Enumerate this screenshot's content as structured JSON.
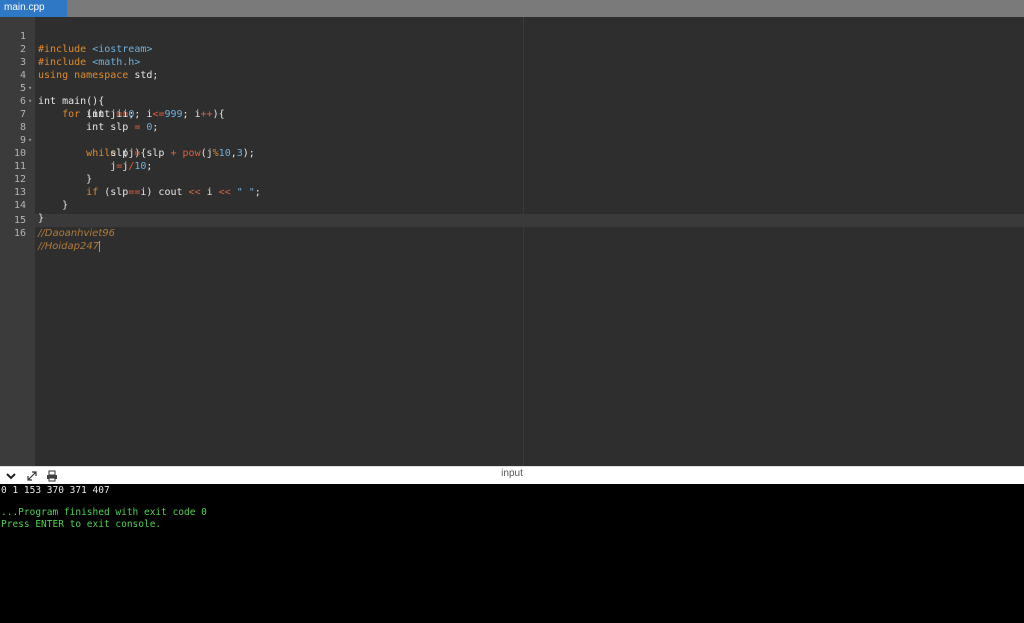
{
  "tab": {
    "label": "main.cpp"
  },
  "editor": {
    "line_numbers": [
      "1",
      "2",
      "3",
      "4",
      "5",
      "6",
      "7",
      "8",
      "9",
      "10",
      "11",
      "12",
      "13",
      "14",
      "15",
      "16"
    ],
    "code": {
      "l1a": "#include ",
      "l1b": "<iostream>",
      "l2a": "#include ",
      "l2b": "<math.h>",
      "l3a": "using namespace",
      "l3b": " std;",
      "l4": "int main(){",
      "l5a": "    ",
      "l5b": "for",
      "l5c": " (int i",
      "l5d": "=",
      "l5e": "0",
      "l5f": "; i",
      "l5g": "<=",
      "l5h": "999",
      "l5i": "; i",
      "l5j": "++",
      "l5k": "){",
      "l6a": "        int j",
      "l6b": "=",
      "l6c": "i;",
      "l7a": "        int slp ",
      "l7b": "=",
      "l7c": " ",
      "l7d": "0",
      "l7e": ";",
      "l8a": "        ",
      "l8b": "while",
      "l8c": " (j){",
      "l9a": "            slp ",
      "l9b": "=",
      "l9c": " slp ",
      "l9d": "+",
      "l9e": " ",
      "l9f": "pow",
      "l9g": "(j",
      "l9h": "%",
      "l9i": "10",
      "l9j": ",",
      "l9k": "3",
      "l9l": ");",
      "l10a": "            j",
      "l10b": "=",
      "l10c": "j",
      "l10d": "/",
      "l10e": "10",
      "l10f": ";",
      "l11": "        }",
      "l12a": "        ",
      "l12b": "if",
      "l12c": " (slp",
      "l12d": "==",
      "l12e": "i) cout ",
      "l12f": "<<",
      "l12g": " i ",
      "l12h": "<<",
      "l12i": " ",
      "l12j": "\" \"",
      "l12k": ";",
      "l13": "    }",
      "l14": "}",
      "l15": "//Daoanhviet96",
      "l16": "//Hoidap247"
    }
  },
  "panel": {
    "title": "input"
  },
  "console": {
    "output": "0 1 153 370 371 407",
    "finished": "...Program finished with exit code 0",
    "press_enter": "Press ENTER to exit console."
  },
  "colors": {
    "keyword": "#e08a2b",
    "operator": "#e0603a",
    "number": "#6fb0de",
    "comment": "#b07a3a",
    "console_green": "#4fd14f",
    "tab_active": "#2f78c6"
  },
  "icons": [
    "chevron-down-icon",
    "expand-icon",
    "print-icon"
  ]
}
